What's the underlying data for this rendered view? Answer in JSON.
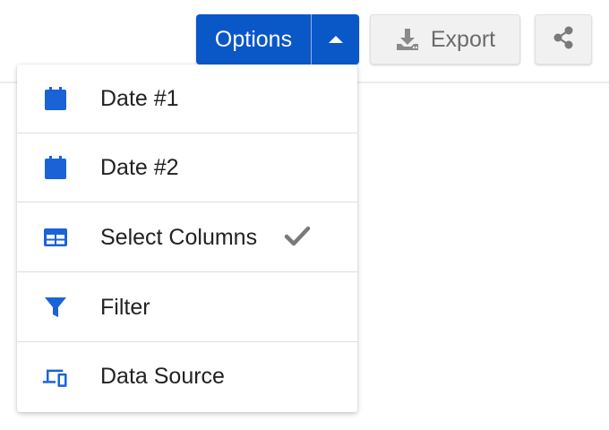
{
  "toolbar": {
    "options_label": "Options",
    "export_label": "Export"
  },
  "menu": {
    "items": [
      {
        "label": "Date #1",
        "icon": "calendar-icon"
      },
      {
        "label": "Date #2",
        "icon": "calendar-icon"
      },
      {
        "label": "Select Columns",
        "icon": "table-columns-icon",
        "checked": true
      },
      {
        "label": "Filter",
        "icon": "filter-icon"
      },
      {
        "label": "Data Source",
        "icon": "devices-icon"
      }
    ]
  },
  "colors": {
    "primary": "#0a57c8",
    "icon_blue": "#1a63d6",
    "gray_button": "#f1f1f1",
    "gray_text": "#6b6b6b",
    "check_gray": "#7a7a7a"
  }
}
